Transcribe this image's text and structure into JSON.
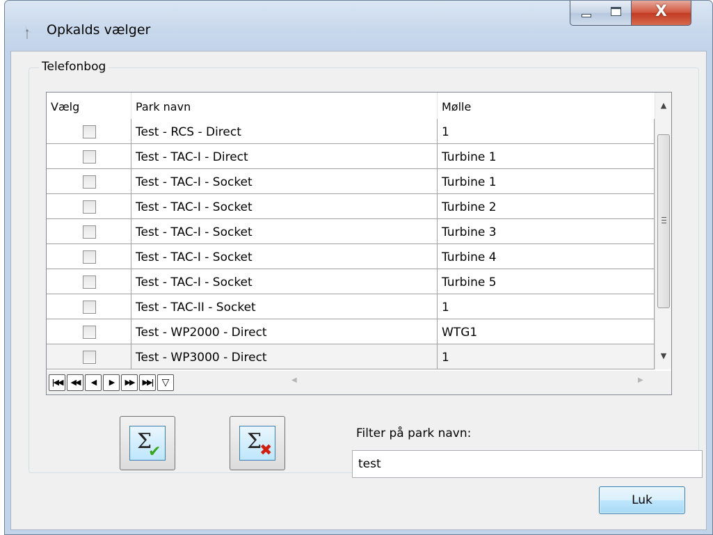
{
  "window": {
    "title": "Opkalds vælger",
    "close_glyph": "X"
  },
  "phonebook": {
    "group_title": "Telefonbog",
    "columns": [
      "Vælg",
      "Park navn",
      "Mølle"
    ],
    "rows": [
      {
        "selected": false,
        "park": "Test - RCS - Direct",
        "turbine": "1"
      },
      {
        "selected": false,
        "park": "Test - TAC-I - Direct",
        "turbine": "Turbine 1"
      },
      {
        "selected": false,
        "park": "Test - TAC-I - Socket",
        "turbine": "Turbine 1"
      },
      {
        "selected": false,
        "park": "Test - TAC-I - Socket",
        "turbine": "Turbine 2"
      },
      {
        "selected": false,
        "park": "Test - TAC-I - Socket",
        "turbine": "Turbine 3"
      },
      {
        "selected": false,
        "park": "Test - TAC-I - Socket",
        "turbine": "Turbine 4"
      },
      {
        "selected": false,
        "park": "Test - TAC-I - Socket",
        "turbine": "Turbine 5"
      },
      {
        "selected": false,
        "park": "Test - TAC-II - Socket",
        "turbine": "1"
      },
      {
        "selected": false,
        "park": "Test - WP2000 - Direct",
        "turbine": "WTG1"
      },
      {
        "selected": false,
        "park": "Test - WP3000 - Direct",
        "turbine": "1"
      }
    ],
    "navigator": [
      "first-icon",
      "prior-page-icon",
      "prior-icon",
      "next-icon",
      "next-page-icon",
      "last-icon",
      "filter-icon"
    ]
  },
  "actions": {
    "select_all_icon": "sigma-check-icon",
    "deselect_all_icon": "sigma-x-icon",
    "filter_label": "Filter på park navn:",
    "filter_value": "test",
    "close_label": "Luk"
  }
}
